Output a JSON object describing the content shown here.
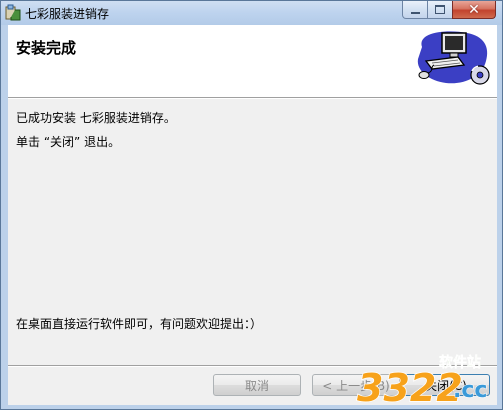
{
  "window": {
    "title": "七彩服装进销存",
    "controls": {
      "minimize_icon": "minimize-icon",
      "maximize_icon": "maximize-icon",
      "close_icon": "close-icon"
    }
  },
  "header": {
    "title": "安装完成"
  },
  "body": {
    "line1": "已成功安装 七彩服装进销存。",
    "line2": "单击 “关闭” 退出。",
    "line3": "在桌面直接运行软件即可，有问题欢迎提出：）"
  },
  "buttons": {
    "cancel": "取消",
    "back": "< 上一步(B)",
    "finish": "关闭(C)"
  },
  "watermark": {
    "brand": "3322",
    "suffix": ".cc",
    "tag": "软件站"
  },
  "colors": {
    "titlebar": "#bdd3ee",
    "client": "#f0f0f0",
    "close_button": "#c2432e"
  }
}
